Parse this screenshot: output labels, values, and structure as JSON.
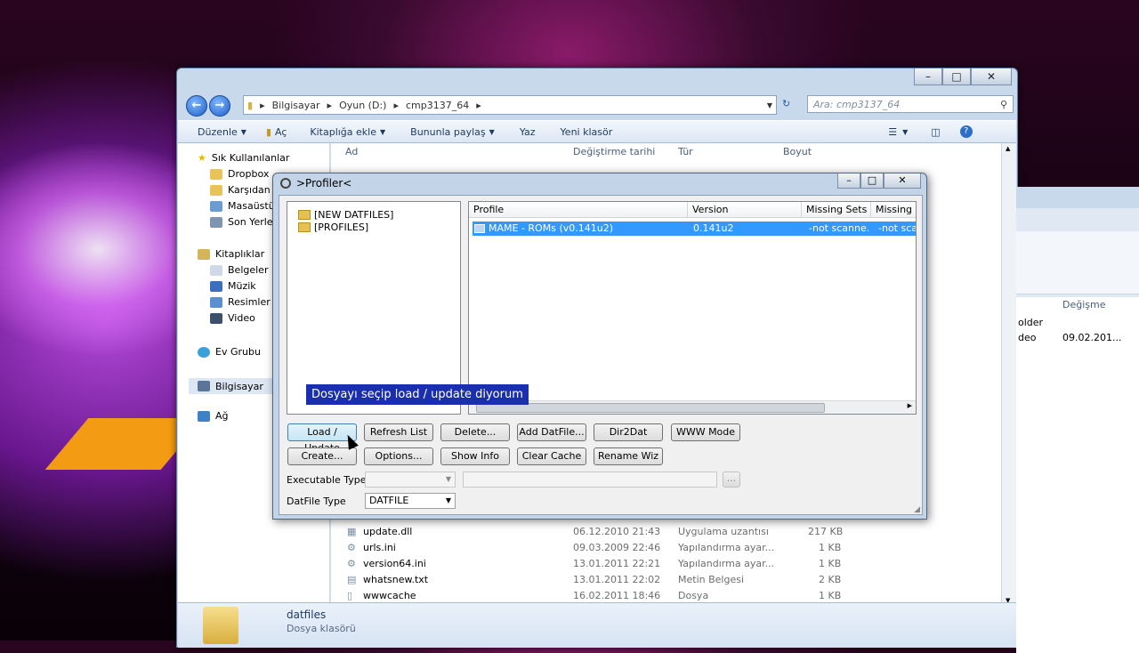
{
  "explorer": {
    "breadcrumb": [
      "Bilgisayar",
      "Oyun (D:)",
      "cmp3137_64"
    ],
    "search_placeholder": "Ara: cmp3137_64",
    "toolbar": [
      "Düzenle",
      "Aç",
      "Kitaplığa ekle",
      "Bununla paylaş",
      "Yaz",
      "Yeni klasör"
    ],
    "columns": [
      "Ad",
      "Değiştirme tarihi",
      "Tür",
      "Boyut"
    ],
    "nav": {
      "favorites_title": "Sık Kullanılanlar",
      "favorites": [
        "Dropbox",
        "Karşıdan Y",
        "Masaüstü",
        "Son Yerler"
      ],
      "libraries_title": "Kitaplıklar",
      "libraries": [
        "Belgeler",
        "Müzik",
        "Resimler",
        "Video"
      ],
      "homegroup": "Ev Grubu",
      "computer": "Bilgisayar",
      "network": "Ağ"
    },
    "files": [
      {
        "name": "update.dll",
        "date": "06.12.2010 21:43",
        "type": "Uygulama uzantısı",
        "size": "217 KB"
      },
      {
        "name": "urls.ini",
        "date": "09.03.2009 22:46",
        "type": "Yapılandırma ayar...",
        "size": "1 KB"
      },
      {
        "name": "version64.ini",
        "date": "13.01.2011 22:21",
        "type": "Yapılandırma ayar...",
        "size": "1 KB"
      },
      {
        "name": "whatsnew.txt",
        "date": "13.01.2011 22:02",
        "type": "Metin Belgesi",
        "size": "2 KB"
      },
      {
        "name": "wwwcache",
        "date": "16.02.2011 18:46",
        "type": "Dosya",
        "size": "1 KB"
      }
    ],
    "details": {
      "name": "datfiles",
      "type": "Dosya klasörü"
    }
  },
  "ghost_window": {
    "col": "Değişme",
    "rows": [
      {
        "name": "older",
        "date": ""
      },
      {
        "name": "deo",
        "date": "09.02.201..."
      }
    ]
  },
  "dialog": {
    "title": ">Profiler<",
    "tree": [
      "[NEW DATFILES]",
      "[PROFILES]"
    ],
    "grid_columns": [
      "Profile",
      "Version",
      "Missing Sets",
      "Missing F"
    ],
    "grid_rows": [
      {
        "profile": "MAME - ROMs (v0.141u2)",
        "version": "0.141u2",
        "missing_sets": "-not scanne...",
        "missing_f": "-not sca"
      }
    ],
    "annotation": "Dosyayı seçip load / update diyorum",
    "buttons_row1": [
      "Load / Update",
      "Refresh List",
      "Delete...",
      "Add DatFile...",
      "Dir2Dat",
      "WWW Mode"
    ],
    "buttons_row2": [
      "Create...",
      "Options...",
      "Show Info",
      "Clear Cache",
      "Rename Wiz"
    ],
    "executable_type_label": "Executable Type",
    "executable_type_value": "",
    "browse_label": "...",
    "datfile_type_label": "DatFile Type",
    "datfile_type_value": "DATFILE"
  }
}
